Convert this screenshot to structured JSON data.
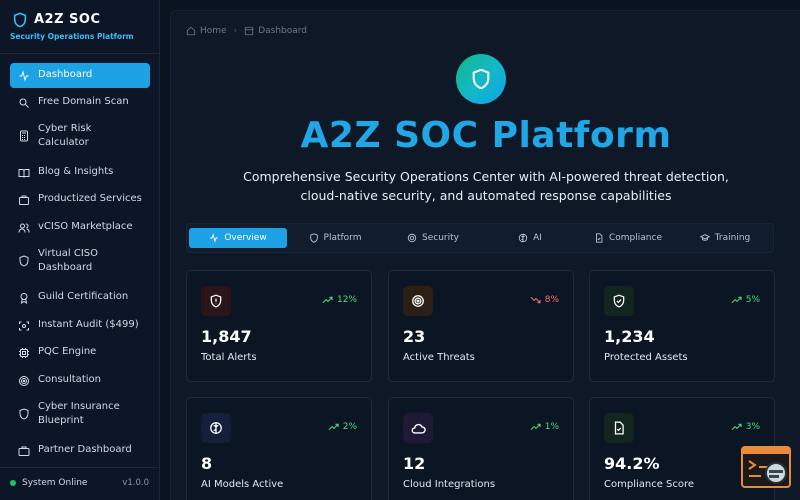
{
  "brand": {
    "title": "A2Z SOC",
    "subtitle": "Security Operations Platform"
  },
  "nav": [
    {
      "label": "Dashboard",
      "icon": "activity-icon",
      "active": true
    },
    {
      "label": "Free Domain Scan",
      "icon": "search-icon"
    },
    {
      "label": "Cyber Risk Calculator",
      "icon": "calculator-icon"
    },
    {
      "label": "Blog & Insights",
      "icon": "book-icon"
    },
    {
      "label": "Productized Services",
      "icon": "package-icon"
    },
    {
      "label": "vCISO Marketplace",
      "icon": "users-icon"
    },
    {
      "label": "Virtual CISO Dashboard",
      "icon": "shield-icon"
    },
    {
      "label": "Guild Certification",
      "icon": "award-icon"
    },
    {
      "label": "Instant Audit ($499)",
      "icon": "scan-icon"
    },
    {
      "label": "PQC Engine",
      "icon": "cpu-icon"
    },
    {
      "label": "Consultation",
      "icon": "target-icon"
    },
    {
      "label": "Cyber Insurance Blueprint",
      "icon": "shield-icon"
    },
    {
      "label": "Partner Dashboard",
      "icon": "briefcase-icon"
    }
  ],
  "footer": {
    "status": "System Online",
    "version": "v1.0.0",
    "status_color": "#22c55e"
  },
  "breadcrumb": {
    "home": "Home",
    "current": "Dashboard"
  },
  "hero": {
    "title": "A2Z SOC Platform",
    "description": "Comprehensive Security Operations Center with AI-powered threat detection, cloud-native security, and automated response capabilities"
  },
  "tabs": [
    {
      "label": "Overview",
      "icon": "activity-icon",
      "active": true
    },
    {
      "label": "Platform",
      "icon": "shield-icon"
    },
    {
      "label": "Security",
      "icon": "target-icon"
    },
    {
      "label": "AI",
      "icon": "brain-icon"
    },
    {
      "label": "Compliance",
      "icon": "file-icon"
    },
    {
      "label": "Training",
      "icon": "graduation-cap-icon"
    }
  ],
  "stats": [
    {
      "value": "1,847",
      "label": "Total Alerts",
      "trend": "12%",
      "direction": "up",
      "icon": "alert-shield-icon",
      "accent": "#ef4444"
    },
    {
      "value": "23",
      "label": "Active Threats",
      "trend": "8%",
      "direction": "down",
      "icon": "target-icon",
      "accent": "#f59e0b"
    },
    {
      "value": "1,234",
      "label": "Protected Assets",
      "trend": "5%",
      "direction": "up",
      "icon": "shield-check-icon",
      "accent": "#22c55e"
    },
    {
      "value": "8",
      "label": "AI Models Active",
      "trend": "2%",
      "direction": "up",
      "icon": "brain-icon",
      "accent": "#3b82f6"
    },
    {
      "value": "12",
      "label": "Cloud Integrations",
      "trend": "1%",
      "direction": "up",
      "icon": "cloud-icon",
      "accent": "#a78bfa"
    },
    {
      "value": "94.2%",
      "label": "Compliance Score",
      "trend": "3%",
      "direction": "up",
      "icon": "file-check-icon",
      "accent": "#22c55e"
    }
  ],
  "colors": {
    "accent": "#1ea2e6",
    "trend_up": "#4ade80",
    "trend_down": "#f87171"
  }
}
